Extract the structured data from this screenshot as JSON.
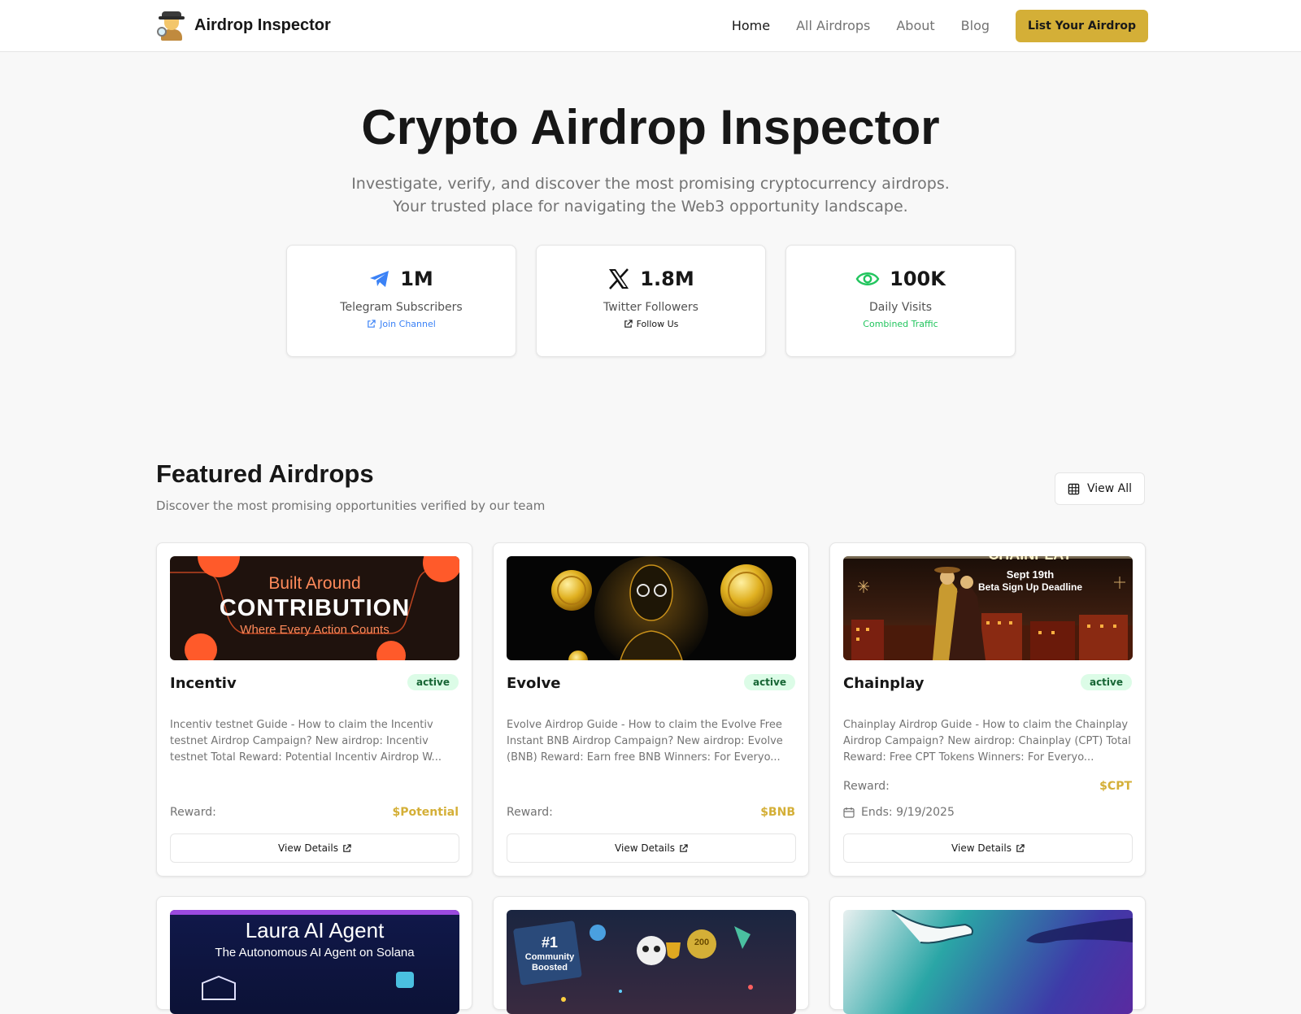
{
  "nav": {
    "brand": "Airdrop Inspector",
    "links": [
      "Home",
      "All Airdrops",
      "About",
      "Blog"
    ],
    "cta": "List Your Airdrop"
  },
  "hero": {
    "title": "Crypto Airdrop Inspector",
    "subtitle": "Investigate, verify, and discover the most promising cryptocurrency airdrops. Your trusted place for navigating the Web3 opportunity landscape."
  },
  "stats": [
    {
      "icon": "telegram-icon",
      "value": "1M",
      "label": "Telegram Subscribers",
      "link": "Join Channel",
      "link_color": "#3b82f6"
    },
    {
      "icon": "x-logo-icon",
      "value": "1.8M",
      "label": "Twitter Followers",
      "link": "Follow Us",
      "link_color": "#171717"
    },
    {
      "icon": "eye-icon",
      "value": "100K",
      "label": "Daily Visits",
      "link": "Combined Traffic",
      "link_color": "#22c55e"
    }
  ],
  "featured": {
    "title": "Featured Airdrops",
    "subtitle": "Discover the most promising opportunities verified by our team",
    "view_all": "View All"
  },
  "cards": [
    {
      "name": "Incentiv",
      "status": "active",
      "image_text": {
        "line1": "Built Around",
        "line2": "CONTRIBUTION",
        "line3": "Where Every Action Counts"
      },
      "description": "Incentiv testnet Guide - How to claim the Incentiv testnet Airdrop Campaign? New airdrop: Incentiv testnet Total Reward: Potential Incentiv Airdrop W...",
      "reward_label": "Reward:",
      "reward": "$Potential",
      "button": "View Details"
    },
    {
      "name": "Evolve",
      "status": "active",
      "description": "Evolve Airdrop Guide - How to claim the Evolve Free Instant BNB Airdrop Campaign? New airdrop: Evolve (BNB) Reward: Earn free BNB Winners: For Everyo...",
      "reward_label": "Reward:",
      "reward": "$BNB",
      "button": "View Details"
    },
    {
      "name": "Chainplay",
      "status": "active",
      "image_text": {
        "line1": "CHAINPLAY",
        "line2": "Sept 19th",
        "line3": "Beta Sign Up Deadline"
      },
      "description": "Chainplay Airdrop Guide - How to claim the Chainplay Airdrop Campaign? New airdrop: Chainplay (CPT) Total Reward: Free CPT Tokens Winners: For Everyo...",
      "reward_label": "Reward:",
      "reward": "$CPT",
      "ends": "Ends: 9/19/2025",
      "button": "View Details"
    }
  ],
  "cards_row2": [
    {
      "image_text": {
        "line1": "Laura AI Agent",
        "line2": "The Autonomous AI Agent on Solana"
      }
    },
    {
      "image_text": {
        "line1": "#1",
        "line2": "Community",
        "line3": "Boosted",
        "coin": "200"
      }
    },
    {}
  ],
  "colors": {
    "accent": "#d4af37",
    "active_bg": "#dcfce7",
    "active_fg": "#166534"
  }
}
